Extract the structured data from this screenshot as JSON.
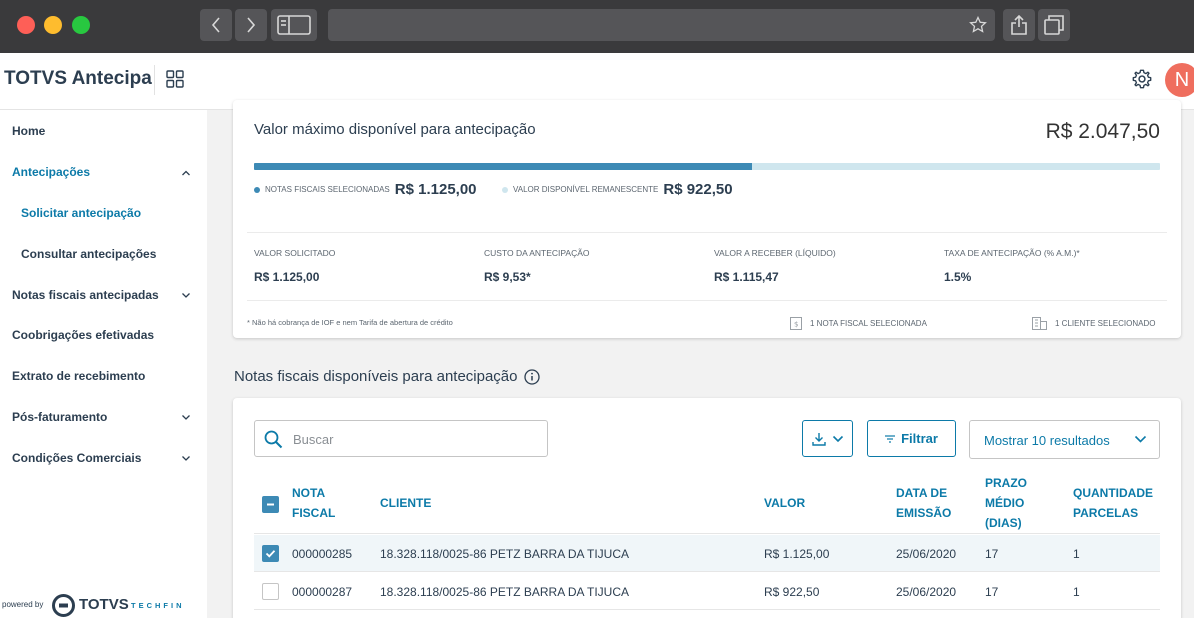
{
  "app": {
    "brand": "TOTVS Antecipa",
    "avatar_initial": "N"
  },
  "sidebar": {
    "items": [
      {
        "label": "Home"
      },
      {
        "label": "Antecipações"
      },
      {
        "label": "Solicitar antecipação"
      },
      {
        "label": "Consultar antecipações"
      },
      {
        "label": "Notas fiscais antecipadas"
      },
      {
        "label": "Coobrigações efetivadas"
      },
      {
        "label": "Extrato de recebimento"
      },
      {
        "label": "Pós-faturamento"
      },
      {
        "label": "Condições Comerciais"
      }
    ],
    "powered_by": "powered by",
    "logo_text": "TOTVS",
    "logo_sub": "TECHFIN"
  },
  "summary": {
    "title": "Valor máximo disponível para antecipação",
    "total": "R$ 2.047,50",
    "progress_fraction": 0.55,
    "legend_selected_label": "NOTAS FISCAIS SELECIONADAS",
    "legend_selected_value": "R$ 1.125,00",
    "legend_remaining_label": "VALOR DISPONÍVEL REMANESCENTE",
    "legend_remaining_value": "R$ 922,50",
    "metrics": [
      {
        "label": "VALOR SOLICITADO",
        "value": "R$ 1.125,00"
      },
      {
        "label": "CUSTO DA ANTECIPAÇÃO",
        "value": "R$ 9,53*"
      },
      {
        "label": "VALOR A RECEBER (LÍQUIDO)",
        "value": "R$ 1.115,47"
      },
      {
        "label": "TAXA DE ANTECIPAÇÃO (% A.M.)*",
        "value": "1.5%"
      }
    ],
    "footnote": "* Não há cobrança de IOF e nem Tarifa de abertura de crédito",
    "notes_selected": "1 NOTA FISCAL SELECIONADA",
    "clients_selected": "1 CLIENTE SELECIONADO"
  },
  "list": {
    "title": "Notas fiscais disponíveis para antecipação",
    "search_placeholder": "Buscar",
    "filter_label": "Filtrar",
    "page_size_label": "Mostrar 10 resultados",
    "columns": {
      "nota_1": "NOTA",
      "nota_2": "FISCAL",
      "cliente": "CLIENTE",
      "valor": "VALOR",
      "data_1": "DATA DE",
      "data_2": "EMISSÃO",
      "prazo_1": "PRAZO",
      "prazo_2": "MÉDIO",
      "prazo_3": "(DIAS)",
      "qtd_1": "QUANTIDADE",
      "qtd_2": "PARCELAS"
    },
    "rows": [
      {
        "nota": "000000285",
        "cliente": "18.328.118/0025-86 PETZ BARRA DA TIJUCA",
        "valor": "R$ 1.125,00",
        "data": "25/06/2020",
        "prazo": "17",
        "parcelas": "1",
        "checked": true
      },
      {
        "nota": "000000287",
        "cliente": "18.328.118/0025-86 PETZ BARRA DA TIJUCA",
        "valor": "R$ 922,50",
        "data": "25/06/2020",
        "prazo": "17",
        "parcelas": "1",
        "checked": false
      }
    ]
  },
  "colors": {
    "accent": "#0c7aa8",
    "bar": "#3d8ab5",
    "bar_track": "#cfe6ee",
    "avatar": "#ef6e5e"
  }
}
